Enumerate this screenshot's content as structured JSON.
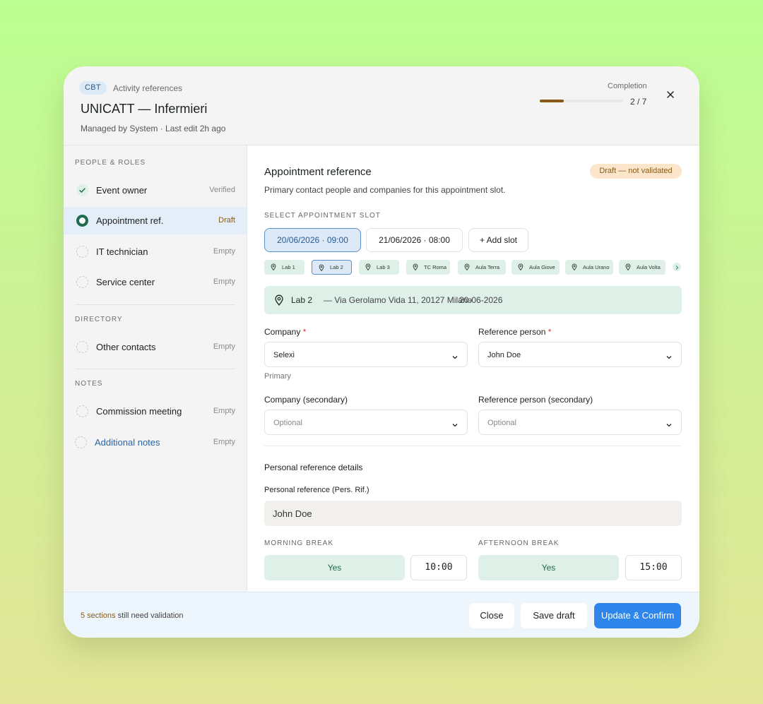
{
  "header": {
    "badge": "CBT",
    "breadcrumb": "Activity references",
    "title": "UNICATT — Infermieri",
    "subtitle": "Managed by System · Last edit 2h ago",
    "completion_label": "Completion",
    "completion_value": "2 / 7",
    "completion_fraction": 0.29
  },
  "sidebar": {
    "sections": [
      {
        "title": "PEOPLE & ROLES",
        "items": [
          {
            "label": "Event owner",
            "status": "Verified"
          },
          {
            "label": "Appointment ref.",
            "status": "Draft"
          },
          {
            "label": "IT technician",
            "status": "Empty"
          },
          {
            "label": "Service center",
            "status": "Empty"
          }
        ]
      },
      {
        "title": "DIRECTORY",
        "items": [
          {
            "label": "Other contacts",
            "status": "Empty"
          }
        ]
      },
      {
        "title": "NOTES",
        "items": [
          {
            "label": "Commission meeting",
            "status": "Empty"
          },
          {
            "label": "Additional notes",
            "status": "Empty"
          }
        ]
      }
    ]
  },
  "main": {
    "title": "Appointment reference",
    "status_badge": "Draft — not validated",
    "description": "Primary contact people and companies for this appointment slot.",
    "slot_label": "SELECT APPOINTMENT SLOT",
    "slots": [
      "20/06/2026 · 09:00",
      "21/06/2026 · 08:00"
    ],
    "add_slot": "+ Add slot",
    "locations": [
      "Lab 1",
      "Lab 2",
      "Lab 3",
      "TC Roma",
      "Aula Terra",
      "Aula Giove",
      "Aula Urano",
      "Aula Volta"
    ],
    "selected_location": {
      "name": "Lab 2",
      "address": "— Via Gerolamo Vida 11, 20127 Milano",
      "date": "20-06-2026"
    },
    "company_label": "Company",
    "company_value": "Selexi",
    "company_hint": "Primary",
    "reference_label": "Reference person",
    "reference_value": "John Doe",
    "company_secondary_label": "Company (secondary)",
    "company_secondary_placeholder": "Optional",
    "reference_secondary_label": "Reference person (secondary)",
    "reference_secondary_placeholder": "Optional",
    "details_title": "Personal reference details",
    "personal_label": "Personal reference (Pers. Rif.)",
    "personal_value": "John Doe",
    "morning_label": "MORNING BREAK",
    "morning_value": "Yes",
    "morning_time": "10:00",
    "afternoon_label": "AFTERNOON BREAK",
    "afternoon_value": "Yes",
    "afternoon_time": "15:00"
  },
  "footer": {
    "count_text": "5 sections",
    "note_text": "still need validation",
    "close": "Close",
    "save": "Save draft",
    "confirm": "Update & Confirm"
  },
  "colors": {
    "accent": "#2f86ea",
    "success": "#1f6b4d",
    "draft": "#8a5a14",
    "mint": "#dff0e8"
  }
}
